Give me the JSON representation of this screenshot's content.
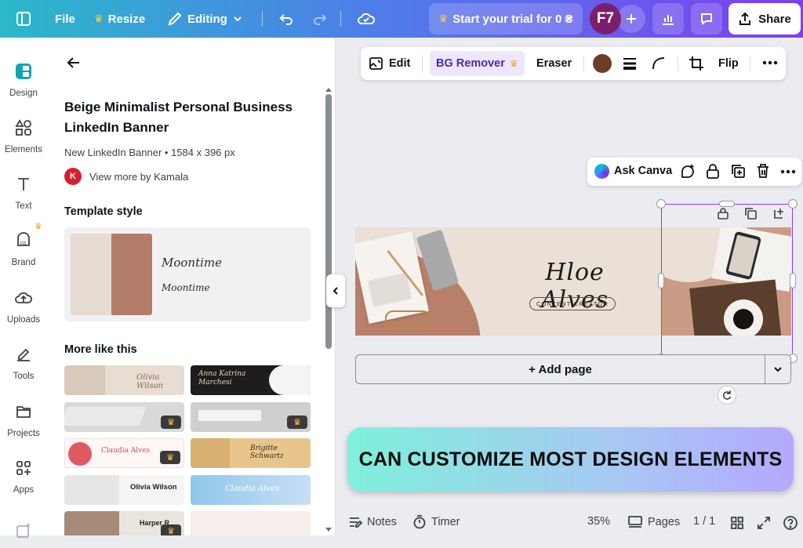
{
  "topbar": {
    "file": "File",
    "resize": "Resize",
    "editing": "Editing",
    "trial": "Start your trial for 0 ₴",
    "avatar": "F7",
    "share": "Share"
  },
  "rail": [
    {
      "label": "Design"
    },
    {
      "label": "Elements"
    },
    {
      "label": "Text"
    },
    {
      "label": "Brand"
    },
    {
      "label": "Uploads"
    },
    {
      "label": "Tools"
    },
    {
      "label": "Projects"
    },
    {
      "label": "Apps"
    }
  ],
  "panel": {
    "title": "Beige Minimalist Personal Business LinkedIn Banner",
    "subtitle": "New LinkedIn Banner • 1584 x 396 px",
    "author_initial": "K",
    "author": "View more by Kamala",
    "template_style": "Template style",
    "font_sample_1": "Moontime",
    "font_sample_2": "Moontime",
    "more_like_this": "More like this",
    "thumbs": [
      {
        "text": "Olivia Wilson"
      },
      {
        "text": "Anna Katrina Marchesi"
      },
      {
        "text": ""
      },
      {
        "text": ""
      },
      {
        "text": "Claudia Alves"
      },
      {
        "text": "Brigitte Schwartz"
      },
      {
        "text": "Olivia Wilson"
      },
      {
        "text": "Claudia Alves"
      },
      {
        "text": "Harper R"
      },
      {
        "text": ""
      }
    ]
  },
  "context_toolbar": {
    "edit": "Edit",
    "bg_remover": "BG Remover",
    "eraser": "Eraser",
    "flip": "Flip",
    "color": "#6b3d26"
  },
  "ask_canva": {
    "label": "Ask Canva"
  },
  "banner": {
    "name": "Hloe Alves",
    "role": "CONTENT CREATOR"
  },
  "add_page": "+ Add page",
  "caption": "CAN CUSTOMIZE MOST DESIGN ELEMENTS",
  "footer": {
    "notes": "Notes",
    "timer": "Timer",
    "zoom": "35%",
    "pages": "Pages",
    "page_count": "1 / 1"
  }
}
